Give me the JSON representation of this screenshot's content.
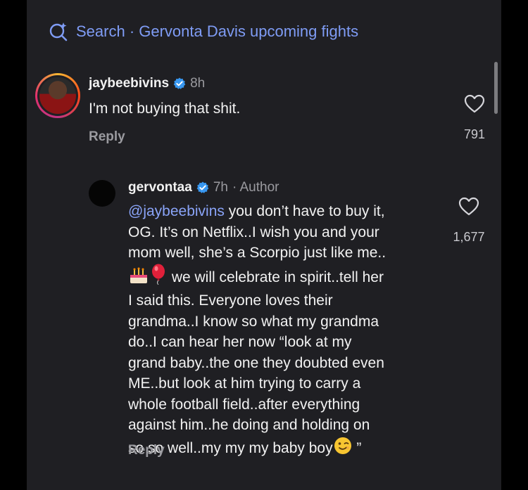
{
  "search": {
    "label": "Search · Gervonta Davis upcoming fights"
  },
  "comments": [
    {
      "username": "jaybeebivins",
      "time": "8h",
      "text": "I'm not buying that shit.",
      "reply_label": "Reply",
      "likes": "791"
    },
    {
      "username": "gervontaa",
      "time": "7h",
      "author_label": "· Author",
      "mention": "@jaybeebivins",
      "text_line1": " you don’t have to buy it,",
      "text_rest": "OG. It’s on Netflix..I wish you and your\nmom well, she’s a Scorpio just like me..",
      "text_after_emoji": " we will celebrate in spirit..tell her\nI said this. Everyone loves their\ngrandma..I know so what my grandma\ndo..I can hear her now “look at my\ngrand baby..the one they doubted even\nME..but look at him trying to carry a\nwhole football field..after everything\nagainst him..he doing and holding on\nso so well..my my my baby boy",
      "text_end": " ”",
      "emojis": [
        "birthday-cake-icon",
        "balloon-icon",
        "winking-face-icon"
      ],
      "reply_label": "Reply",
      "likes": "1,677"
    }
  ],
  "colors": {
    "background": "#1f1f23",
    "accent": "#7f9cf5",
    "verified": "#3897f0"
  }
}
